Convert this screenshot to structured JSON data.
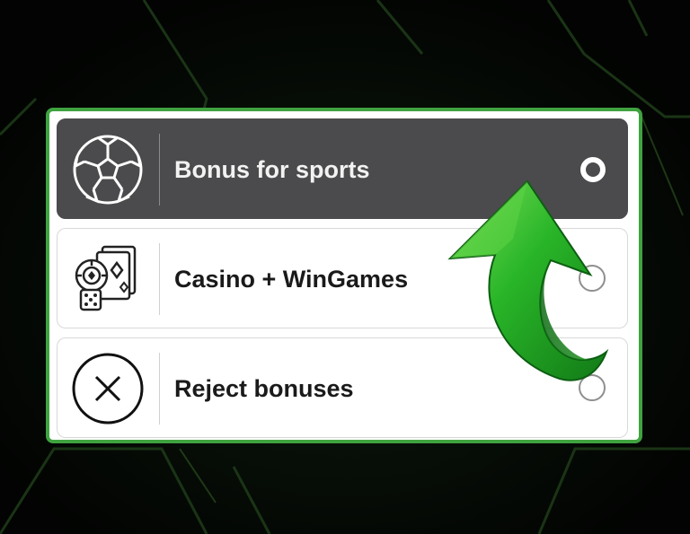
{
  "colors": {
    "panel_border": "#3fa33f",
    "selected_bg": "#4b4b4d",
    "arrow_green": "#25b525"
  },
  "options": [
    {
      "label": "Bonus for sports",
      "icon": "soccer-ball-icon",
      "selected": true
    },
    {
      "label": "Casino + WinGames",
      "icon": "casino-chips-cards-dice-icon",
      "selected": false
    },
    {
      "label": "Reject bonuses",
      "icon": "circle-x-icon",
      "selected": false
    }
  ],
  "overlay": {
    "icon": "green-curved-arrow-icon"
  }
}
